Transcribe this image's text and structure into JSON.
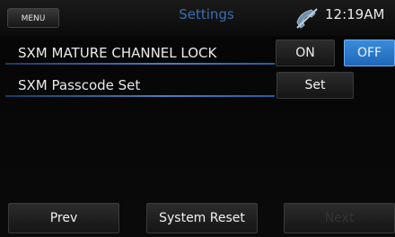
{
  "status_bar": {
    "menu_label": "MENU",
    "title": "Settings",
    "clock": "12:19AM",
    "phone_icon": "phone-disconnected-icon"
  },
  "rows": [
    {
      "label": "SXM MATURE CHANNEL LOCK",
      "on_label": "ON",
      "off_label": "OFF",
      "selected": "OFF"
    },
    {
      "label": "SXM Passcode Set",
      "button_label": "Set"
    }
  ],
  "bottom": {
    "prev_label": "Prev",
    "system_reset_label": "System Reset",
    "next_label": "Next"
  },
  "colors": {
    "accent": "#2f79d0",
    "title": "#3a6fb0"
  }
}
